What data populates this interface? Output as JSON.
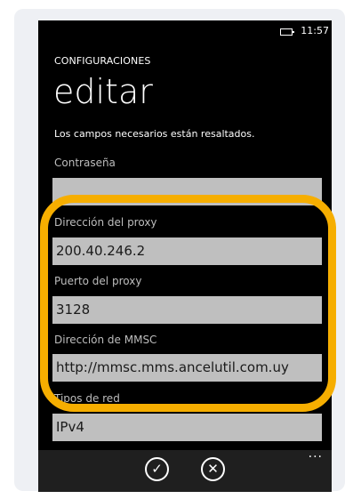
{
  "status": {
    "time": "11:57"
  },
  "header": {
    "section": "CONFIGURACIONES",
    "title": "editar",
    "note": "Los campos necesarios están resaltados."
  },
  "fields": [
    {
      "label": "Contraseña",
      "value": ""
    },
    {
      "label": "Dirección del proxy",
      "value": "200.40.246.2"
    },
    {
      "label": "Puerto del proxy",
      "value": "3128"
    },
    {
      "label": "Dirección de MMSC",
      "value": "http://mmsc.mms.ancelutil.com.uy"
    },
    {
      "label": "Tipos de red",
      "value": "IPv4"
    }
  ],
  "appbar": {
    "save_glyph": "✓",
    "cancel_glyph": "✕",
    "more": "···"
  },
  "colors": {
    "highlight": "#f6ae00",
    "field_bg": "#bfbfbf"
  }
}
